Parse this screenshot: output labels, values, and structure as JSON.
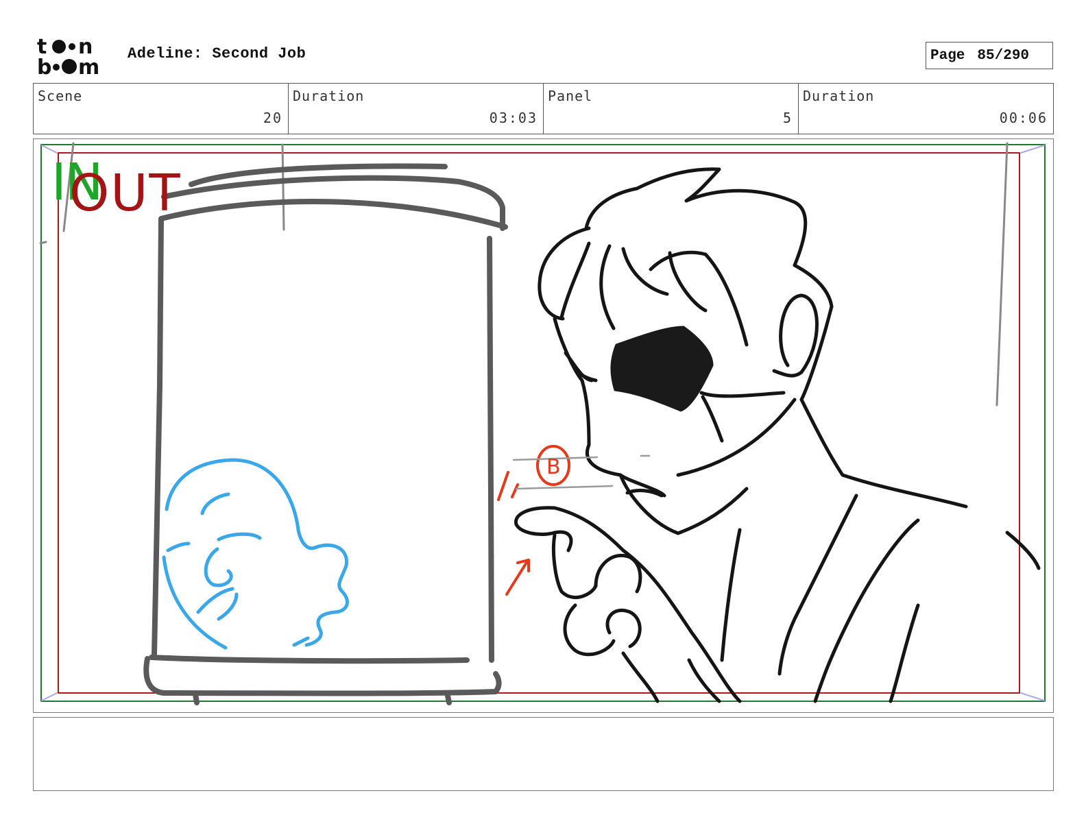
{
  "header": {
    "logo_text": "toon boom",
    "project_title": "Adeline: Second Job",
    "page_label": "Page",
    "page_number": "85/290"
  },
  "info": {
    "scene_label": "Scene",
    "scene_value": "20",
    "scene_duration_label": "Duration",
    "scene_duration_value": "03:03",
    "panel_label": "Panel",
    "panel_value": "5",
    "panel_duration_label": "Duration",
    "panel_duration_value": "00:06"
  },
  "panel": {
    "in_marker": "IN",
    "out_marker": "OUT",
    "annotation_letter": "B"
  },
  "notes": {
    "text": ""
  },
  "colors": {
    "safe_frame_green": "#1e7a2a",
    "camera_frame_red": "#b01818",
    "in_marker": "#1fa62a",
    "out_marker": "#a31515",
    "sketch_blue": "#3aa7e8",
    "annotation_red": "#e8381a",
    "sketch_gray": "#5a5a5a"
  }
}
